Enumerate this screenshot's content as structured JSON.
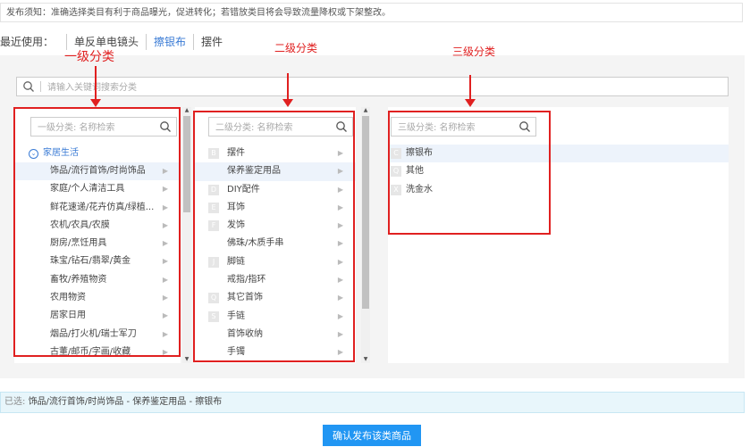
{
  "notice": {
    "text": "发布须知：准确选择类目有利于商品曝光，促进转化；若错放类目将会导致流量降权或下架整改。"
  },
  "recent": {
    "label": "最近使用：",
    "items": [
      {
        "label": "单反单电镜头"
      },
      {
        "label": "擦银布"
      },
      {
        "label": "摆件"
      }
    ]
  },
  "search": {
    "placeholder": "请输入关键词搜索分类"
  },
  "annotations": {
    "level1": "一级分类",
    "level2": "二级分类",
    "level3": "三级分类"
  },
  "level1": {
    "placeholder": "一级分类: 名称检索",
    "group": "家居生活",
    "items": [
      {
        "label": "饰品/流行首饰/时尚饰品"
      },
      {
        "label": "家庭/个人清洁工具"
      },
      {
        "label": "鲜花速递/花卉仿真/绿植..."
      },
      {
        "label": "农机/农具/农膜"
      },
      {
        "label": "厨房/烹饪用具"
      },
      {
        "label": "珠宝/钻石/翡翠/黄金"
      },
      {
        "label": "畜牧/养殖物资"
      },
      {
        "label": "农用物资"
      },
      {
        "label": "居家日用"
      },
      {
        "label": "烟品/打火机/瑞士军刀"
      },
      {
        "label": "古董/邮币/字画/收藏"
      }
    ]
  },
  "level2": {
    "placeholder": "二级分类: 名称检索",
    "items": [
      {
        "letter": "B",
        "label": "摆件"
      },
      {
        "letter": "",
        "label": "保养鉴定用品"
      },
      {
        "letter": "D",
        "label": "DIY配件"
      },
      {
        "letter": "E",
        "label": "耳饰"
      },
      {
        "letter": "F",
        "label": "发饰"
      },
      {
        "letter": "",
        "label": "佛珠/木质手串"
      },
      {
        "letter": "J",
        "label": "脚链"
      },
      {
        "letter": "",
        "label": "戒指/指环"
      },
      {
        "letter": "Q",
        "label": "其它首饰"
      },
      {
        "letter": "S",
        "label": "手链"
      },
      {
        "letter": "",
        "label": "首饰收纳"
      },
      {
        "letter": "",
        "label": "手镯"
      }
    ]
  },
  "level3": {
    "placeholder": "三级分类: 名称检索",
    "items": [
      {
        "letter": "C",
        "label": "擦银布"
      },
      {
        "letter": "Q",
        "label": "其他"
      },
      {
        "letter": "X",
        "label": "洗金水"
      }
    ]
  },
  "selected": {
    "label": "已选:",
    "path": "饰品/流行首饰/时尚饰品 - 保养鉴定用品 - 擦银布"
  },
  "confirm": {
    "label": "确认发布该类商品"
  }
}
